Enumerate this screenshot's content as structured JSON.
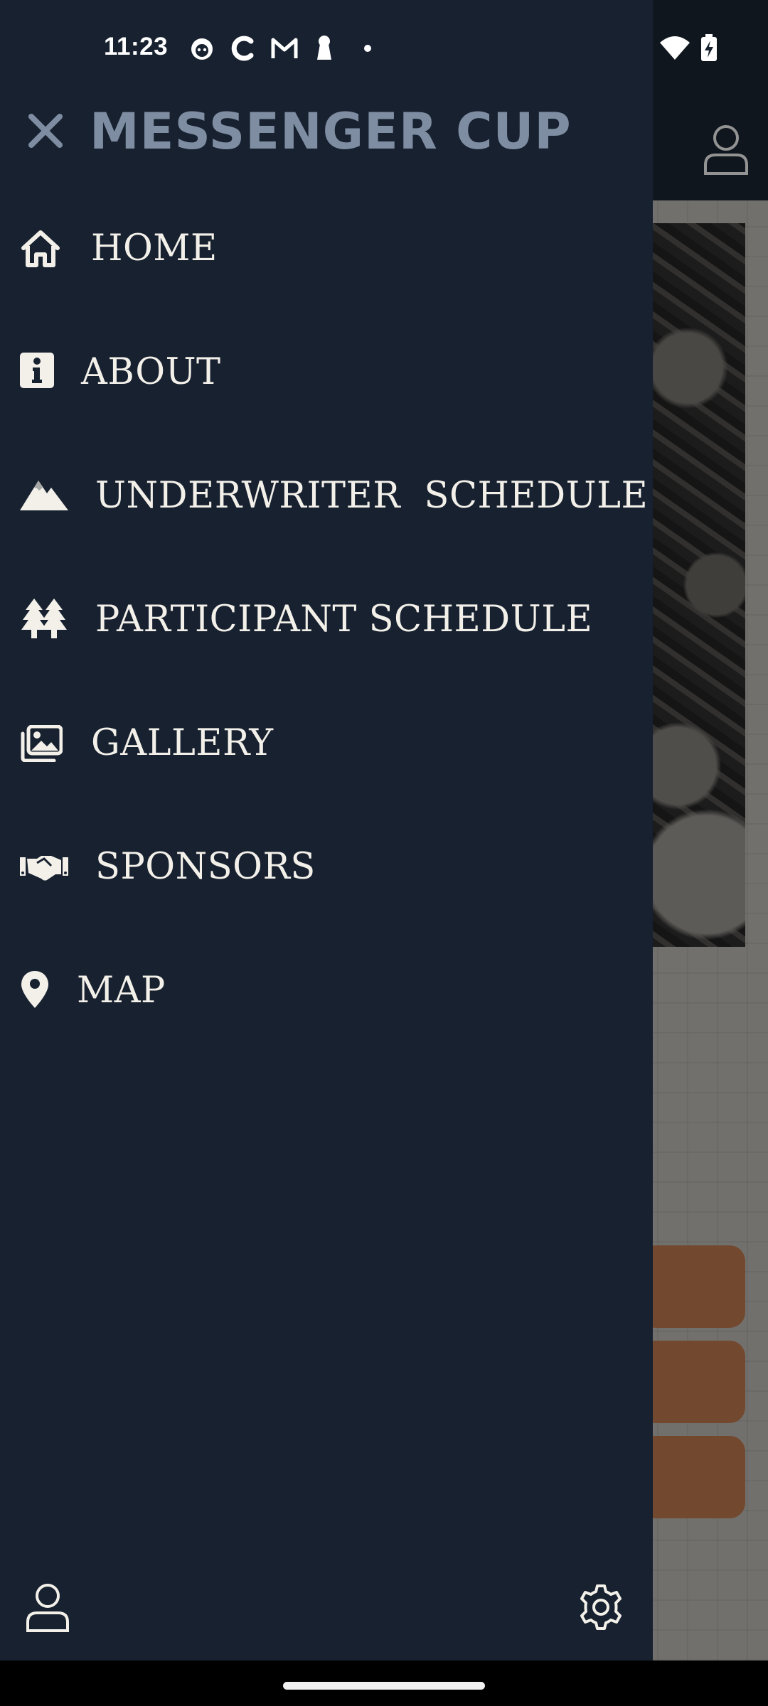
{
  "status_bar": {
    "time": "11:23",
    "notification_icons": [
      "smiley-face-icon",
      "c-logo-icon",
      "gmail-icon",
      "keyhole-icon",
      "dot-icon"
    ],
    "system_icons": [
      "wifi-icon",
      "battery-charging-icon"
    ]
  },
  "drawer": {
    "title": "MESSENGER CUP",
    "close_icon": "close-icon",
    "menu": [
      {
        "label": "HOME",
        "icon": "home-icon"
      },
      {
        "label": "ABOUT",
        "icon": "info-icon"
      },
      {
        "label": "UNDERWRITER  SCHEDULE",
        "icon": "mountain-icon"
      },
      {
        "label": "PARTICIPANT SCHEDULE",
        "icon": "trees-icon"
      },
      {
        "label": "GALLERY",
        "icon": "images-icon"
      },
      {
        "label": "SPONSORS",
        "icon": "handshake-icon"
      },
      {
        "label": "MAP",
        "icon": "map-pin-icon"
      }
    ],
    "footer": {
      "user_icon": "user-icon",
      "settings_icon": "gear-icon"
    }
  },
  "background_app": {
    "header_icon": "user-icon",
    "button_count": 3
  },
  "colors": {
    "drawer_bg": "#17212f",
    "title": "#7f8da3",
    "menu_text": "#f3f0ea",
    "accent_button": "#a96c45"
  }
}
